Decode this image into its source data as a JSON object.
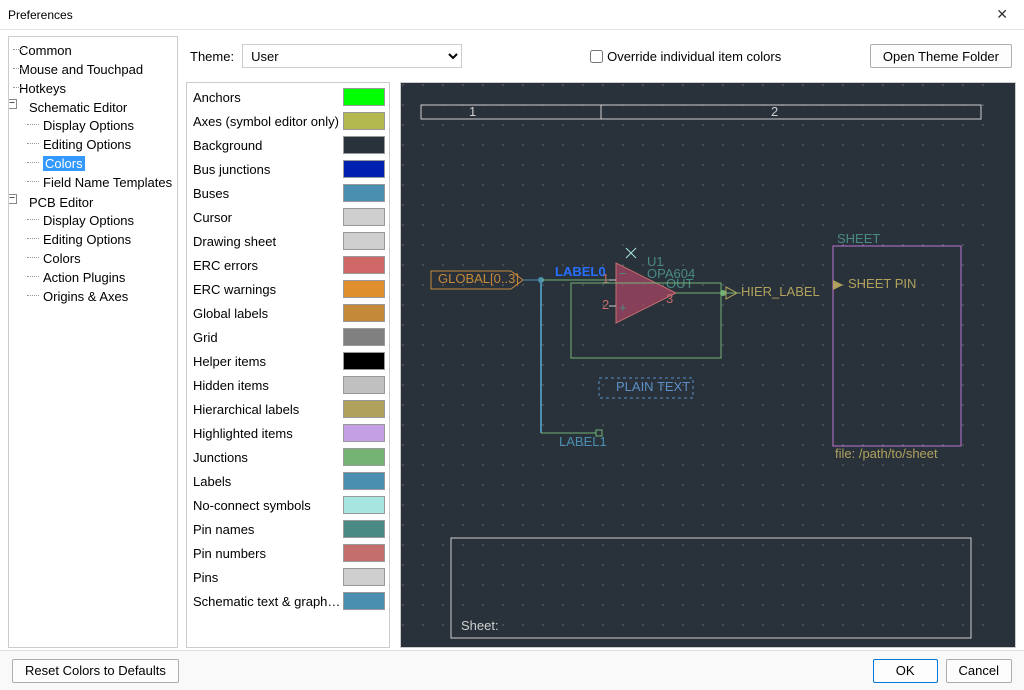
{
  "window": {
    "title": "Preferences",
    "close": "✕"
  },
  "tree": {
    "common": "Common",
    "mouse": "Mouse and Touchpad",
    "hotkeys": "Hotkeys",
    "schematic": "Schematic Editor",
    "sch_display": "Display Options",
    "sch_editing": "Editing Options",
    "sch_colors": "Colors",
    "sch_fieldnames": "Field Name Templates",
    "pcb": "PCB Editor",
    "pcb_display": "Display Options",
    "pcb_editing": "Editing Options",
    "pcb_colors": "Colors",
    "pcb_actionplugins": "Action Plugins",
    "pcb_origins": "Origins & Axes"
  },
  "theme_row": {
    "label": "Theme:",
    "value": "User",
    "override": "Override individual item colors",
    "open_folder": "Open Theme Folder"
  },
  "colors": [
    {
      "name": "Anchors",
      "hex": "#00ff00"
    },
    {
      "name": "Axes (symbol editor only)",
      "hex": "#b3b84f"
    },
    {
      "name": "Background",
      "hex": "#29323b"
    },
    {
      "name": "Bus junctions",
      "hex": "#0020b0"
    },
    {
      "name": "Buses",
      "hex": "#4a8fb0"
    },
    {
      "name": "Cursor",
      "hex": "#cfcfcf"
    },
    {
      "name": "Drawing sheet",
      "hex": "#cfcfcf"
    },
    {
      "name": "ERC errors",
      "hex": "#d06868"
    },
    {
      "name": "ERC warnings",
      "hex": "#e08f2e"
    },
    {
      "name": "Global labels",
      "hex": "#c5893a"
    },
    {
      "name": "Grid",
      "hex": "#808080"
    },
    {
      "name": "Helper items",
      "hex": "#000000"
    },
    {
      "name": "Hidden items",
      "hex": "#c0c0c0"
    },
    {
      "name": "Hierarchical labels",
      "hex": "#b0a25c"
    },
    {
      "name": "Highlighted items",
      "hex": "#c49fe4"
    },
    {
      "name": "Junctions",
      "hex": "#74b374"
    },
    {
      "name": "Labels",
      "hex": "#4a8fb0"
    },
    {
      "name": "No-connect symbols",
      "hex": "#a7e5e1"
    },
    {
      "name": "Pin names",
      "hex": "#4a8a84"
    },
    {
      "name": "Pin numbers",
      "hex": "#c56e6e"
    },
    {
      "name": "Pins",
      "hex": "#cfcfcf"
    },
    {
      "name": "Schematic text & graphics",
      "hex": "#4a8fb0"
    }
  ],
  "preview": {
    "ruler1": "1",
    "ruler2": "2",
    "global_label": "GLOBAL[0..3]",
    "label0": "LABEL0",
    "hier_label": "HIER_LABEL",
    "u1": "U1",
    "opa": "OPA604",
    "out": "OUT",
    "plain_text": "PLAIN TEXT",
    "label1": "LABEL1",
    "sheet": "SHEET",
    "sheet_pin": "SHEET PIN",
    "file": "file: /path/to/sheet",
    "sheet2": "Sheet:"
  },
  "buttons": {
    "reset": "Reset Colors to Defaults",
    "ok": "OK",
    "cancel": "Cancel"
  }
}
